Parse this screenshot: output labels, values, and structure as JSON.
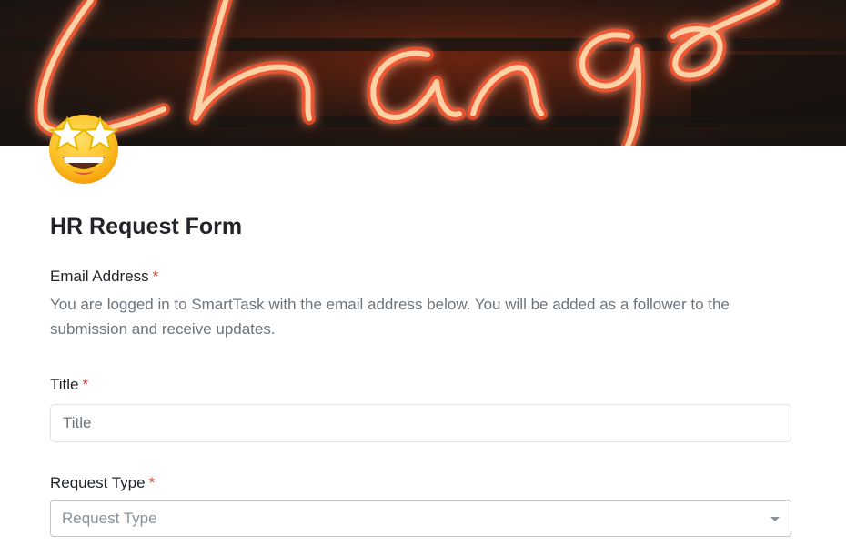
{
  "cover": {
    "image": "neon-sign-change",
    "colors": {
      "background": "#2a1a12",
      "neon_glow": "#ff5a2a",
      "neon_core": "#ffd3a8"
    }
  },
  "avatar": {
    "icon": "star-struck-emoji-icon"
  },
  "form": {
    "title": "HR Request Form",
    "required_marker": "*",
    "email": {
      "label": "Email Address",
      "help": "You are logged in to SmartTask with the email address below. You will be added as a follower to the submission and receive updates."
    },
    "title_field": {
      "label": "Title",
      "placeholder": "Title",
      "value": ""
    },
    "request_type": {
      "label": "Request Type",
      "placeholder": "Request Type"
    }
  },
  "colors": {
    "required": "#d9372c",
    "help_text": "#6c757d",
    "input_border": "#dfe3e7"
  }
}
